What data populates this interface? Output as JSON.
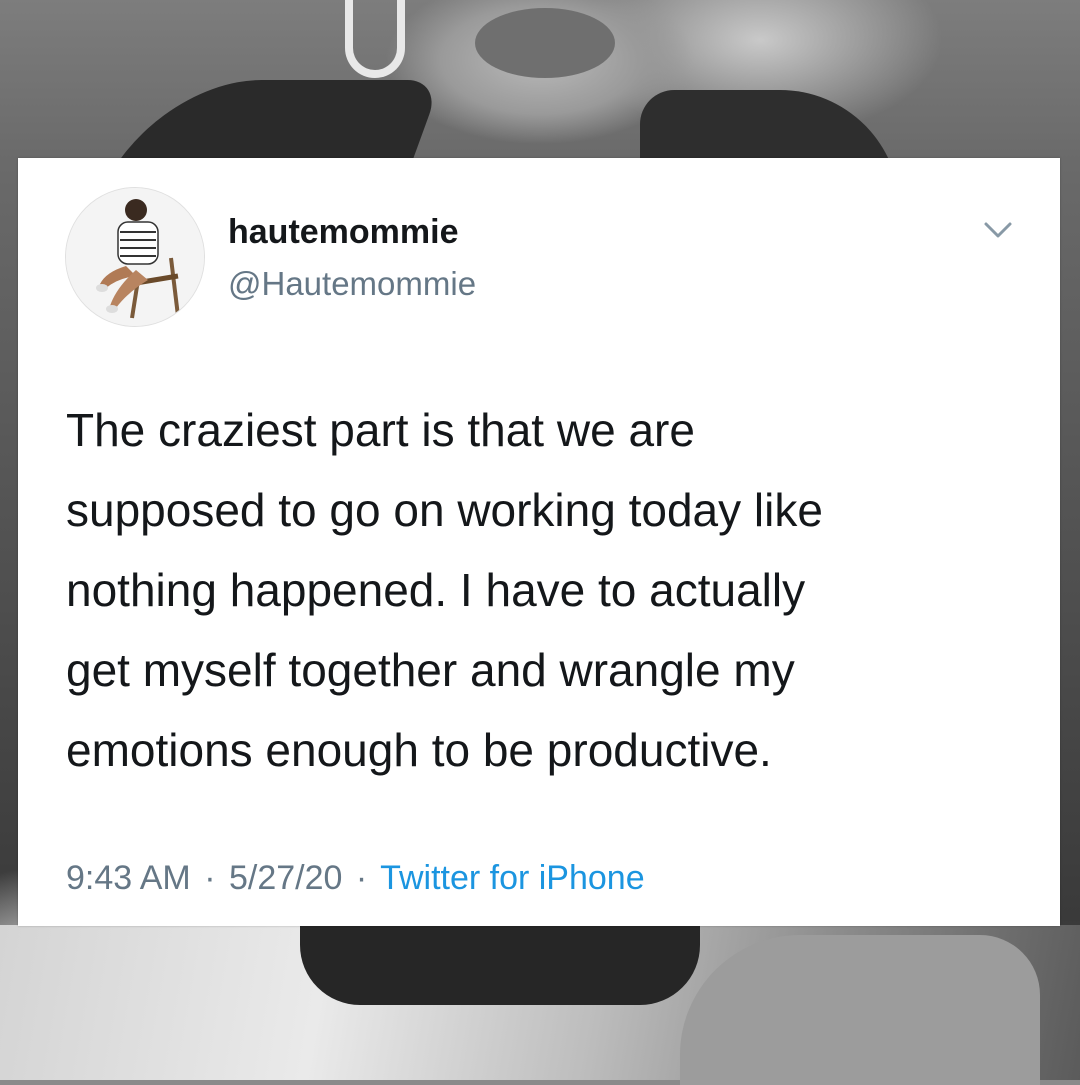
{
  "tweet": {
    "display_name": "hautemommie",
    "handle": "@Hautemommie",
    "avatar_icon": "person-seated-on-chair",
    "menu_icon": "chevron-down-icon",
    "text_lines": [
      "The craziest part is that we are",
      "supposed to go on working today like",
      "nothing happened. I have to actually",
      "get myself together and wrangle my",
      "emotions enough to be productive."
    ],
    "time": "9:43 AM",
    "separator": "·",
    "date": "5/27/20",
    "source": "Twitter for iPhone"
  },
  "colors": {
    "name": "#14171a",
    "secondary": "#657786",
    "link": "#1b95e0",
    "card_bg": "#ffffff"
  }
}
